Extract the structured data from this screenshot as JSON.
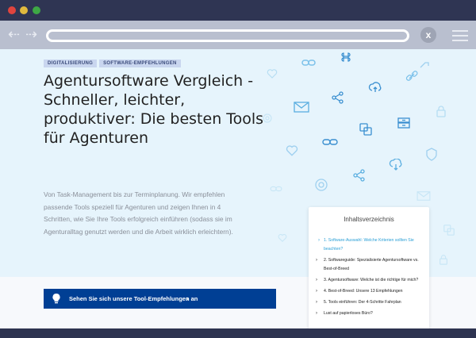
{
  "browser": {
    "nav_back": "⇠",
    "nav_forward": "⇢",
    "close_label": "x"
  },
  "tags": [
    "DIGITALISIERUNG",
    "SOFTWARE-EMPFEHLUNGEN"
  ],
  "headline": "Agentursoftware Vergleich - Schneller, leichter, produktiver: Die besten Tools für Agenturen",
  "lead": "Von Task-Management bis zur Terminplanung. Wir empfehlen passende Tools speziell für Agenturen und zeigen Ihnen in 4 Schritten, wie Sie Ihre Tools erfolgreich einführen (sodass sie im Agenturalltag genutzt werden und die Arbeit wirklich erleichtern).",
  "cta": {
    "label": "Sehen Sie sich unsere Tool-Empfehlungen an",
    "icon": "lightbulb-icon"
  },
  "toc": {
    "title": "Inhaltsverzeichnis",
    "items": [
      "1. Software-Auswahl: Welche Kriterien sollten Sie beachten?",
      "2. Softwareguide: Spezialisierte Agentursoftware vs. Best-of-Breed",
      "3. Agentursoftware: Welche ist die richtige für mich?",
      "4. Best-of-Breed: Unsere 13 Empfehlungen",
      "5. Tools einführen: Der 4-Schritte Fahrplan",
      "Lust auf papierloses Büro?"
    ],
    "active_index": 0
  },
  "colors": {
    "accent": "#2a9fd6",
    "cta_bg": "#003f94",
    "page_bg": "#e6f4fc",
    "icon_color": "#5aaee0"
  }
}
